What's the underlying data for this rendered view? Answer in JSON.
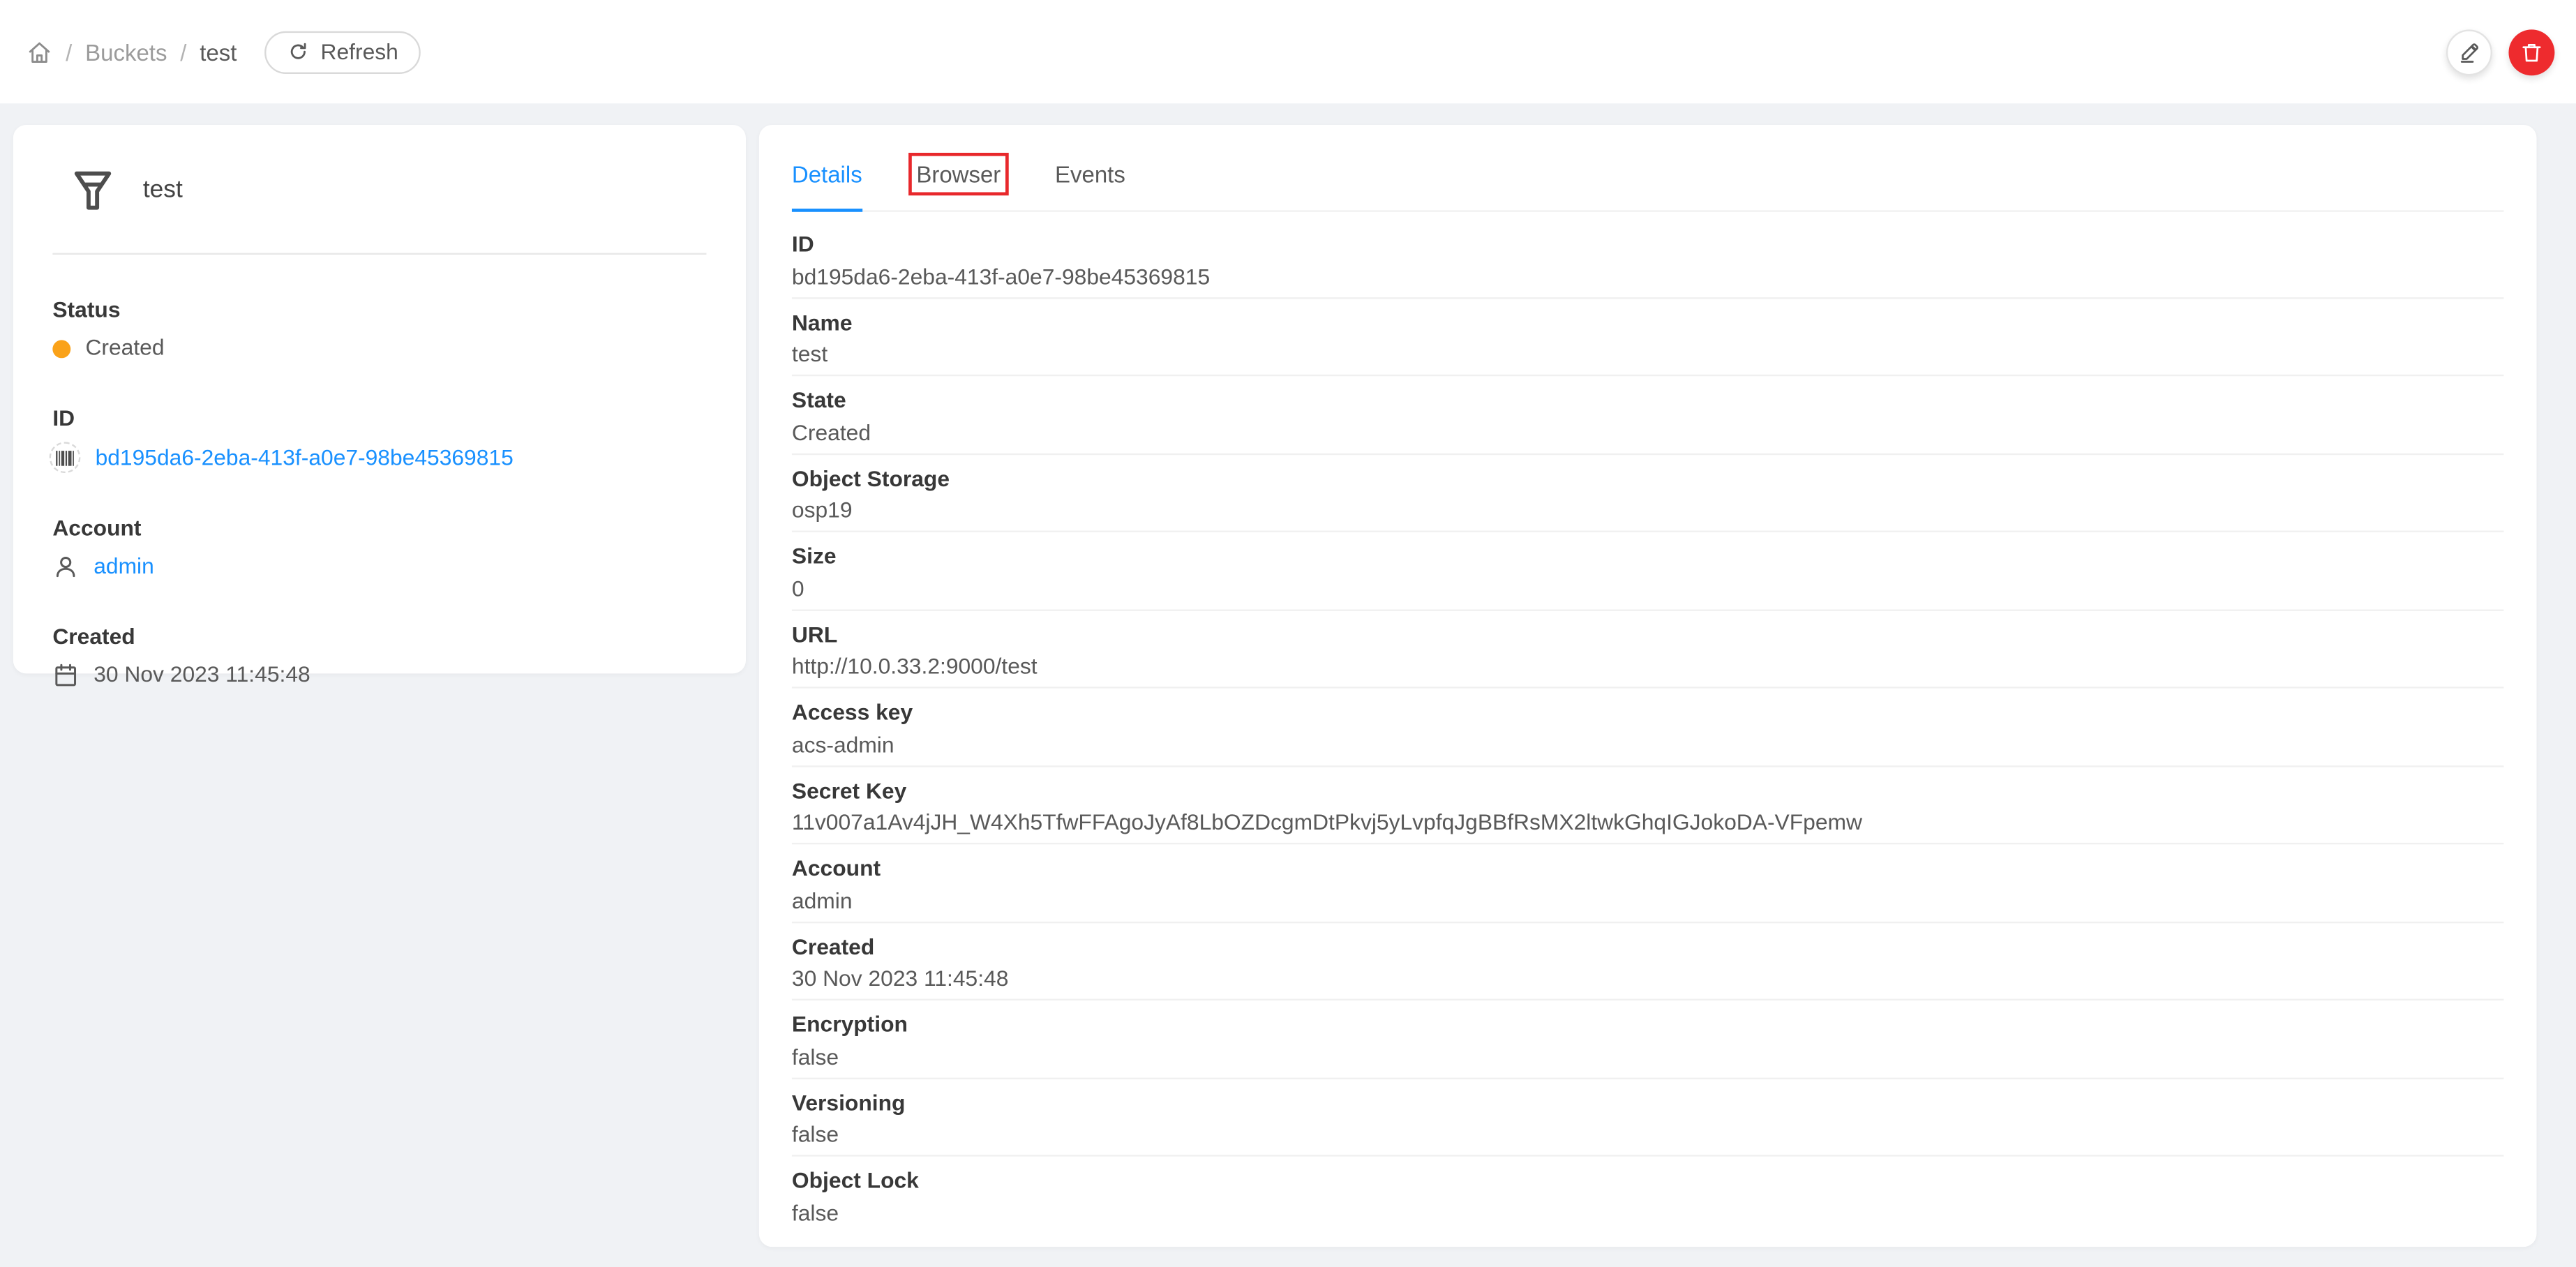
{
  "colors": {
    "accent_blue": "#1890ff",
    "status_orange": "#faa219",
    "danger_red": "#ee2b2e",
    "annotation_red": "#e8282c",
    "page_background": "#f0f2f5"
  },
  "header": {
    "breadcrumb": {
      "home_icon": "home-icon",
      "separator": "/",
      "items": [
        "Buckets",
        "test"
      ]
    },
    "refresh_label": "Refresh",
    "actions": [
      {
        "name": "edit",
        "icon": "pencil-icon"
      },
      {
        "name": "delete",
        "icon": "trash-icon"
      }
    ]
  },
  "info_card": {
    "icon": "bucket-funnel-icon",
    "title": "test",
    "fields": [
      {
        "label": "Status",
        "value": "Created",
        "icon": "status-dot"
      },
      {
        "label": "ID",
        "value": "bd195da6-2eba-413f-a0e7-98be45369815",
        "icon": "barcode-icon"
      },
      {
        "label": "Account",
        "value": "admin",
        "icon": "user-icon"
      },
      {
        "label": "Created",
        "value": "30 Nov 2023 11:45:48",
        "icon": "calendar-icon"
      }
    ]
  },
  "tabs": [
    {
      "label": "Details",
      "active": true
    },
    {
      "label": "Browser",
      "annotated": true
    },
    {
      "label": "Events",
      "active": false
    }
  ],
  "details": [
    {
      "label": "ID",
      "value": "bd195da6-2eba-413f-a0e7-98be45369815"
    },
    {
      "label": "Name",
      "value": "test"
    },
    {
      "label": "State",
      "value": "Created"
    },
    {
      "label": "Object Storage",
      "value": "osp19"
    },
    {
      "label": "Size",
      "value": "0"
    },
    {
      "label": "URL",
      "value": "http://10.0.33.2:9000/test"
    },
    {
      "label": "Access key",
      "value": "acs-admin"
    },
    {
      "label": "Secret Key",
      "value": "11v007a1Av4jJH_W4Xh5TfwFFAgoJyAf8LbOZDcgmDtPkvj5yLvpfqJgBBfRsMX2ltwkGhqIGJokoDA-VFpemw"
    },
    {
      "label": "Account",
      "value": "admin"
    },
    {
      "label": "Created",
      "value": "30 Nov 2023 11:45:48"
    },
    {
      "label": "Encryption",
      "value": "false"
    },
    {
      "label": "Versioning",
      "value": "false"
    },
    {
      "label": "Object Lock",
      "value": "false"
    }
  ]
}
